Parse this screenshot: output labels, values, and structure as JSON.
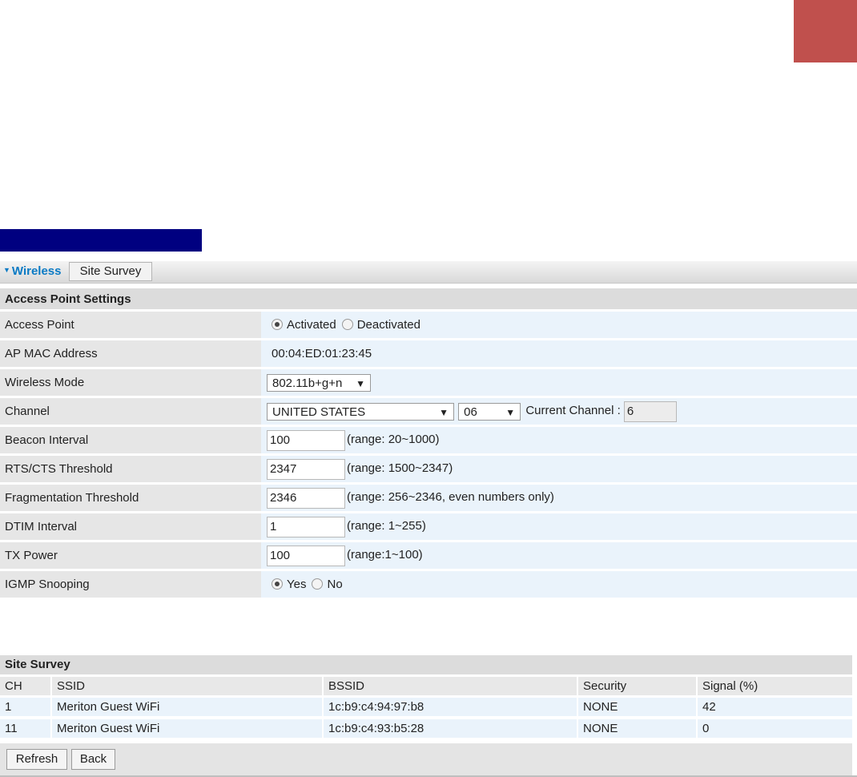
{
  "colors": {
    "corner_block": "#c0504d",
    "nav_bar": "#000080",
    "active_tab": "#0a7ac4"
  },
  "tabs": [
    {
      "label": "Wireless",
      "active": true
    },
    {
      "label": "Site Survey",
      "active": false
    }
  ],
  "access_point": {
    "section_title": "Access Point Settings",
    "rows": {
      "access_point": {
        "label": "Access Point",
        "options": [
          "Activated",
          "Deactivated"
        ],
        "selected": "Activated"
      },
      "mac": {
        "label": "AP MAC Address",
        "value": "00:04:ED:01:23:45"
      },
      "wireless_mode": {
        "label": "Wireless Mode",
        "value": "802.11b+g+n"
      },
      "channel": {
        "label": "Channel",
        "country": "UNITED STATES",
        "channel": "06",
        "current_label": "Current Channel :",
        "current_value": "6"
      },
      "beacon": {
        "label": "Beacon Interval",
        "value": "100",
        "hint": "(range: 20~1000)"
      },
      "rts": {
        "label": "RTS/CTS Threshold",
        "value": "2347",
        "hint": "(range: 1500~2347)"
      },
      "frag": {
        "label": "Fragmentation Threshold",
        "value": "2346",
        "hint": "(range: 256~2346, even numbers only)"
      },
      "dtim": {
        "label": "DTIM Interval",
        "value": "1",
        "hint": "(range: 1~255)"
      },
      "tx": {
        "label": "TX Power",
        "value": "100",
        "hint": "(range:1~100)"
      },
      "igmp": {
        "label": "IGMP Snooping",
        "options": [
          "Yes",
          "No"
        ],
        "selected": "Yes"
      }
    }
  },
  "site_survey": {
    "title": "Site Survey",
    "columns": [
      "CH",
      "SSID",
      "BSSID",
      "Security",
      "Signal (%)"
    ],
    "rows": [
      [
        "1",
        "Meriton Guest WiFi",
        "1c:b9:c4:94:97:b8",
        "NONE",
        "42"
      ],
      [
        "11",
        "Meriton Guest WiFi",
        "1c:b9:c4:93:b5:28",
        "NONE",
        "0"
      ]
    ],
    "buttons": {
      "refresh": "Refresh",
      "back": "Back"
    }
  }
}
